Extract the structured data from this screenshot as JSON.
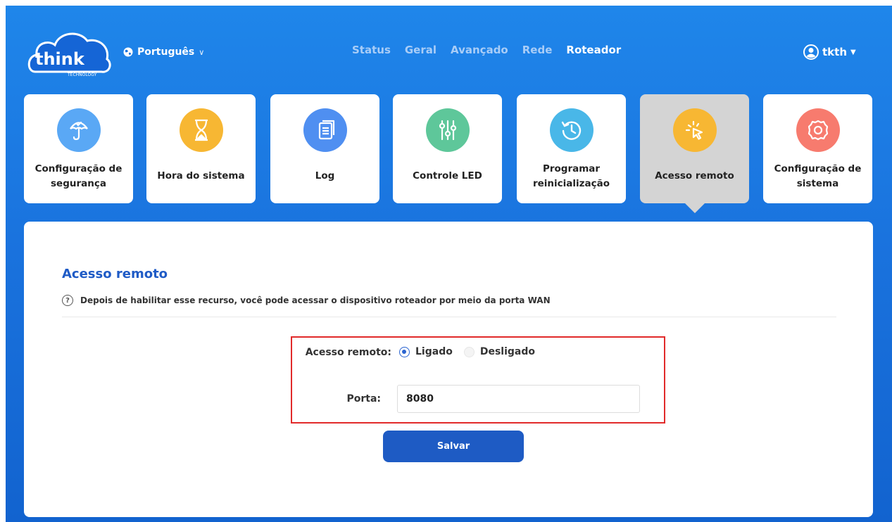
{
  "brand": {
    "logo_text": "think",
    "logo_subtext": "TECHNOLOGY"
  },
  "header": {
    "language": "Português",
    "nav": [
      "Status",
      "Geral",
      "Avançado",
      "Rede",
      "Roteador"
    ],
    "active_nav": "Roteador",
    "user": "tkth"
  },
  "cards": [
    {
      "label": "Configuração de segurança",
      "icon": "umbrella-icon",
      "color": "#5aa8f5",
      "active": false
    },
    {
      "label": "Hora do sistema",
      "icon": "hourglass-icon",
      "color": "#f7b733",
      "active": false
    },
    {
      "label": "Log",
      "icon": "document-icon",
      "color": "#4f8ff1",
      "active": false
    },
    {
      "label": "Controle LED",
      "icon": "sliders-icon",
      "color": "#5ec79a",
      "active": false
    },
    {
      "label": "Programar reinicialização",
      "icon": "history-icon",
      "color": "#49b7e8",
      "active": false
    },
    {
      "label": "Acesso remoto",
      "icon": "remote-cursor-icon",
      "color": "#f7b733",
      "active": true
    },
    {
      "label": "Configuração de sistema",
      "icon": "settings-gear-icon",
      "color": "#f77b6e",
      "active": false
    }
  ],
  "panel": {
    "title": "Acesso remoto",
    "hint": "Depois de habilitar esse recurso, você pode acessar o dispositivo roteador por meio da porta WAN",
    "remote_label": "Acesso remoto:",
    "option_on": "Ligado",
    "option_off": "Desligado",
    "selected": "Ligado",
    "port_label": "Porta:",
    "port_value": "8080",
    "save_label": "Salvar"
  },
  "colors": {
    "background": "#1a73de",
    "accent": "#1e5bc4",
    "highlight": "#e12a2a"
  }
}
